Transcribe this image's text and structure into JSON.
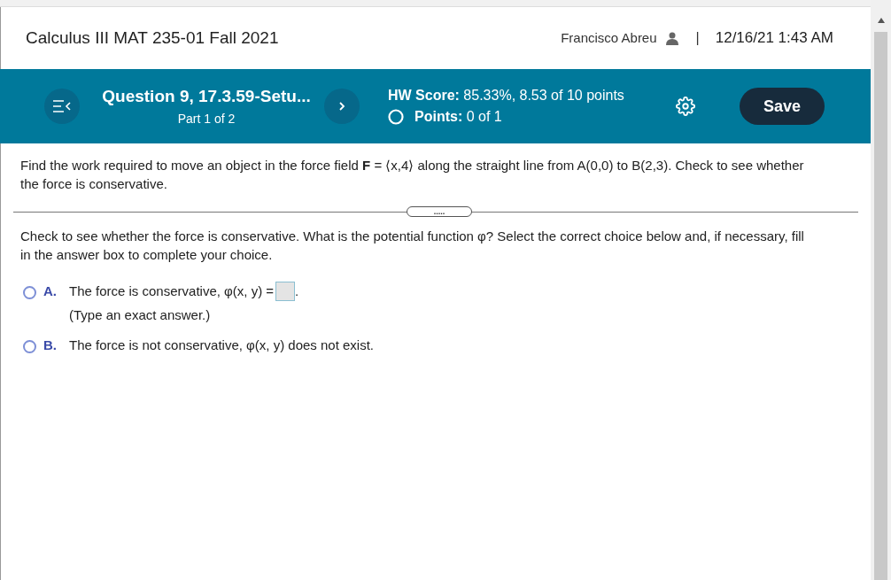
{
  "header": {
    "course": "Calculus III MAT 235-01 Fall 2021",
    "user": "Francisco Abreu",
    "separator": "|",
    "datetime": "12/16/21 1:43 AM"
  },
  "toolbar": {
    "question_title": "Question 9, 17.3.59-Setu...",
    "part": "Part 1 of 2",
    "hw_score_label": "HW Score:",
    "hw_score": "85.33%, 8.53 of 10 points",
    "points_label": "Points:",
    "points": "0 of 1",
    "save": "Save"
  },
  "question": {
    "prompt": "Find the work required to move an object in the force field **F** = ⟨x,4⟩ along the straight line from A(0,0) to B(2,3). Check to see whether the force is conservative.",
    "expand_dots": ".....",
    "part_prompt": "Check to see whether the force is conservative. What is the potential function φ? Select the correct choice below and, if necessary, fill in the answer box to complete your choice.",
    "choices": [
      {
        "kind": "answer",
        "letter": "A.",
        "text": "The force is conservative, φ(x, y) =",
        "after": ".",
        "hint": "(Type an exact answer.)",
        "selected": false
      },
      {
        "kind": "plain",
        "letter": "B.",
        "text": "The force is not conservative, φ(x, y) does not exist.",
        "selected": false
      }
    ]
  }
}
